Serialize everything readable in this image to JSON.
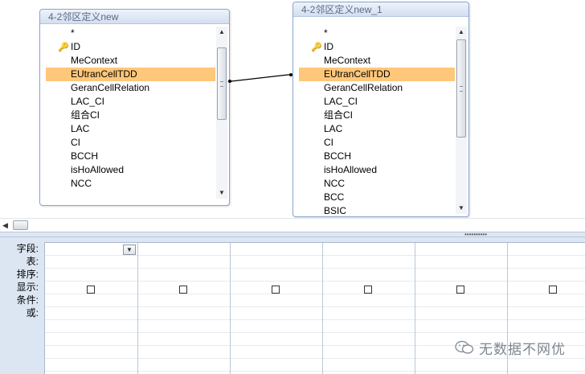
{
  "tables": [
    {
      "title": "4-2邻区定义new",
      "fields": [
        "*",
        "ID",
        "MeContext",
        "EUtranCellTDD",
        "GeranCellRelation",
        "LAC_CI",
        "组合CI",
        "LAC",
        "CI",
        "BCCH",
        "isHoAllowed",
        "NCC"
      ],
      "key_field": "ID",
      "selected_field": "EUtranCellTDD"
    },
    {
      "title": "4-2邻区定义new_1",
      "fields": [
        "*",
        "ID",
        "MeContext",
        "EUtranCellTDD",
        "GeranCellRelation",
        "LAC_CI",
        "组合CI",
        "LAC",
        "CI",
        "BCCH",
        "isHoAllowed",
        "NCC",
        "BCC",
        "BSIC"
      ],
      "key_field": "ID",
      "selected_field": "EUtranCellTDD"
    }
  ],
  "grid": {
    "row_labels": [
      "字段:",
      "表:",
      "排序:",
      "显示:",
      "条件:",
      "或:"
    ]
  },
  "watermark": "无数据不网优",
  "icons": {
    "key": "key-icon",
    "scroll_up": "triangle-up-icon",
    "scroll_down": "triangle-down-icon",
    "scroll_left": "triangle-left-icon",
    "dropdown": "chevron-down-icon",
    "watermark_logo": "wechat-icon"
  },
  "colors": {
    "selected_field_bg": "#ffc77a",
    "title_bar": "#d3def0",
    "grid_panel_bg": "#dce6f2"
  }
}
